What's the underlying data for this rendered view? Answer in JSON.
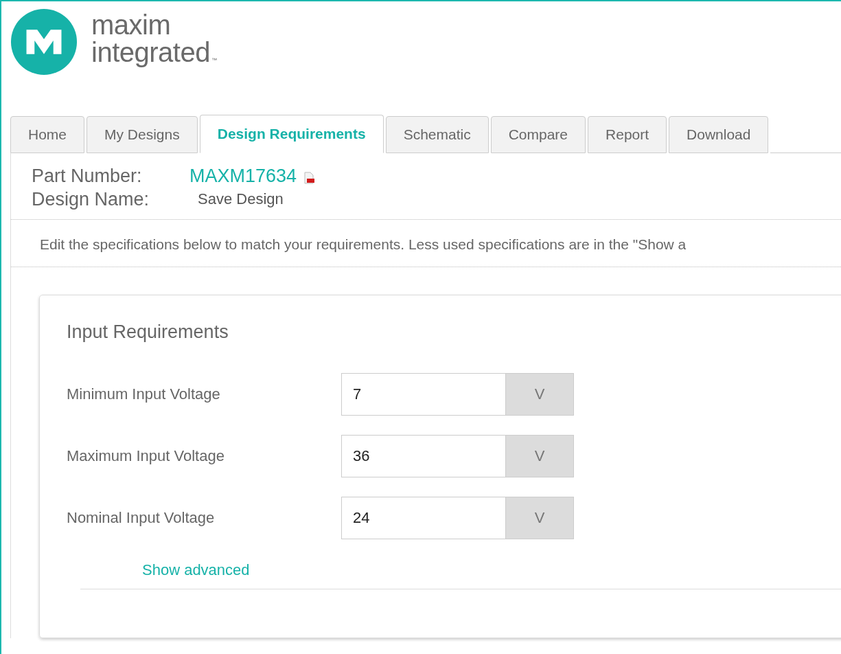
{
  "logo": {
    "lines": [
      "maxim",
      "integrated"
    ],
    "mark": "™"
  },
  "tabs": [
    {
      "label": "Home",
      "selected": false
    },
    {
      "label": "My Designs",
      "selected": false
    },
    {
      "label": "Design Requirements",
      "selected": true
    },
    {
      "label": "Schematic",
      "selected": false
    },
    {
      "label": "Compare",
      "selected": false
    },
    {
      "label": "Report",
      "selected": false
    },
    {
      "label": "Download",
      "selected": false
    }
  ],
  "part": {
    "label": "Part Number:",
    "value": "MAXM17634"
  },
  "design": {
    "label": "Design Name:",
    "value": "Save Design"
  },
  "instructions": "Edit the specifications below to match your requirements. Less used specifications are in the \"Show a",
  "card": {
    "title": "Input Requirements",
    "fields": [
      {
        "label": "Minimum Input Voltage",
        "value": "7",
        "unit": "V"
      },
      {
        "label": "Maximum Input Voltage",
        "value": "36",
        "unit": "V"
      },
      {
        "label": "Nominal Input Voltage",
        "value": "24",
        "unit": "V"
      }
    ],
    "link": "Show advanced"
  }
}
